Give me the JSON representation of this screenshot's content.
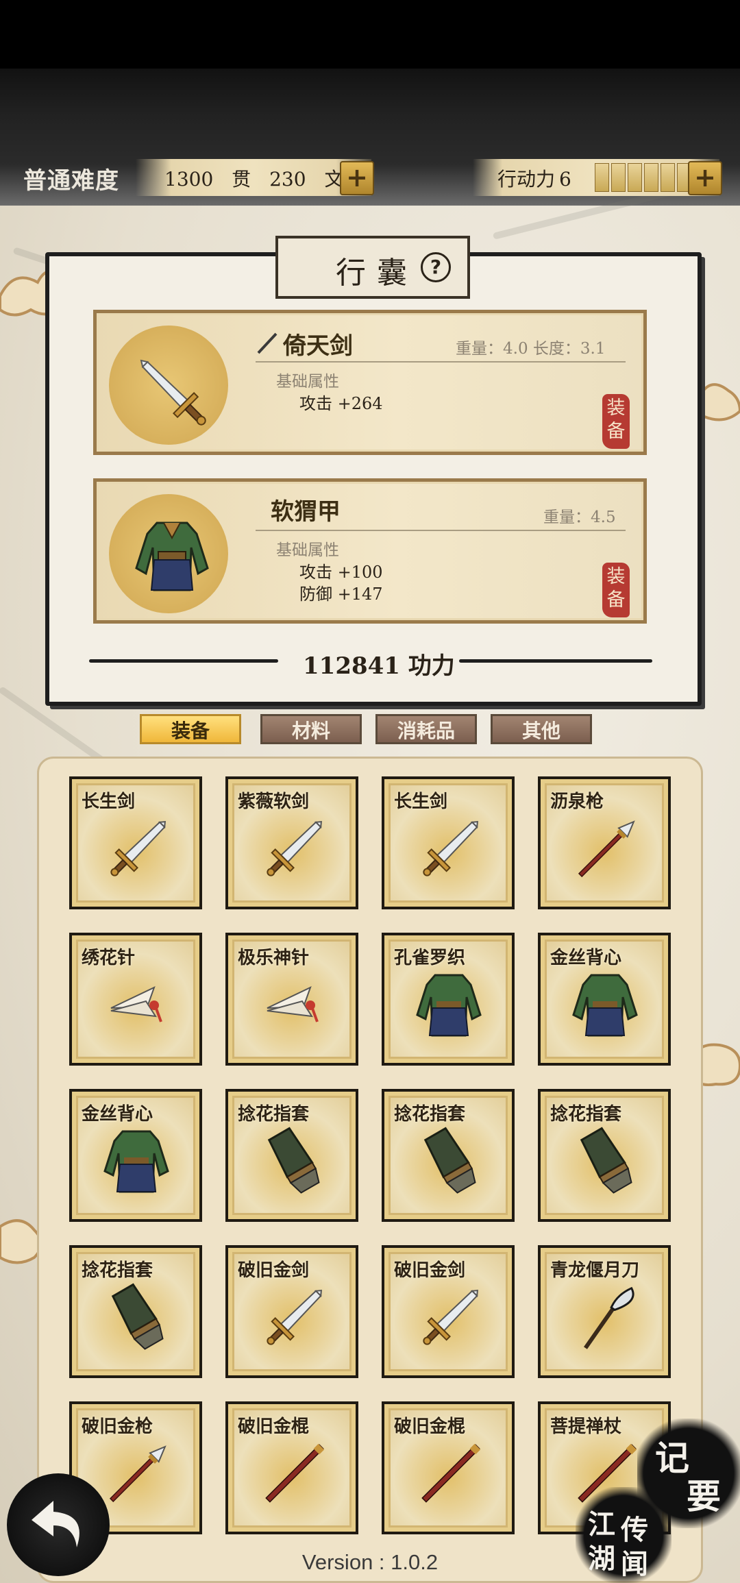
{
  "header": {
    "difficulty": "普通难度",
    "money": {
      "guan_value": "1300",
      "guan_unit": "贯",
      "wen_value": "230",
      "wen_unit": "文"
    },
    "action_label": "行动力",
    "action_value": "6",
    "add_symbol": "+"
  },
  "bag": {
    "title": "行囊",
    "help_symbol": "?",
    "equipped": [
      {
        "name": "倚天剑",
        "meta": "重量：4.0  长度：3.1",
        "attr_title": "基础属性",
        "attrs": [
          "攻击 +264"
        ],
        "equip_label": [
          "装",
          "备"
        ],
        "icon": "sword-icon"
      },
      {
        "name": "软猬甲",
        "meta": "重量：4.5",
        "attr_title": "基础属性",
        "attrs": [
          "攻击 +100",
          "防御 +147"
        ],
        "equip_label": [
          "装",
          "备"
        ],
        "icon": "armor-icon"
      }
    ],
    "power_value": "112841",
    "power_unit": "功力"
  },
  "tabs": [
    {
      "label": "装备",
      "active": true
    },
    {
      "label": "材料",
      "active": false
    },
    {
      "label": "消耗品",
      "active": false
    },
    {
      "label": "其他",
      "active": false
    }
  ],
  "inventory": [
    {
      "name": "长生剑",
      "icon": "sword"
    },
    {
      "name": "紫薇软剑",
      "icon": "sword"
    },
    {
      "name": "长生剑",
      "icon": "sword"
    },
    {
      "name": "沥泉枪",
      "icon": "spear"
    },
    {
      "name": "绣花针",
      "icon": "needle"
    },
    {
      "name": "极乐神针",
      "icon": "needle"
    },
    {
      "name": "孔雀罗织",
      "icon": "armor"
    },
    {
      "name": "金丝背心",
      "icon": "armor"
    },
    {
      "name": "金丝背心",
      "icon": "armor"
    },
    {
      "name": "捻花指套",
      "icon": "gauntlet"
    },
    {
      "name": "捻花指套",
      "icon": "gauntlet"
    },
    {
      "name": "捻花指套",
      "icon": "gauntlet"
    },
    {
      "name": "捻花指套",
      "icon": "gauntlet"
    },
    {
      "name": "破旧金剑",
      "icon": "sword"
    },
    {
      "name": "破旧金剑",
      "icon": "sword"
    },
    {
      "name": "青龙偃月刀",
      "icon": "glaive"
    },
    {
      "name": "破旧金枪",
      "icon": "spear"
    },
    {
      "name": "破旧金棍",
      "icon": "staff"
    },
    {
      "name": "破旧金棍",
      "icon": "staff"
    },
    {
      "name": "菩提禅杖",
      "icon": "staff"
    }
  ],
  "footer": {
    "memo_chars": [
      "记",
      "要"
    ],
    "jianghu_chars": [
      "江",
      "湖",
      "传",
      "闻"
    ],
    "version": "Version : 1.0.2"
  }
}
